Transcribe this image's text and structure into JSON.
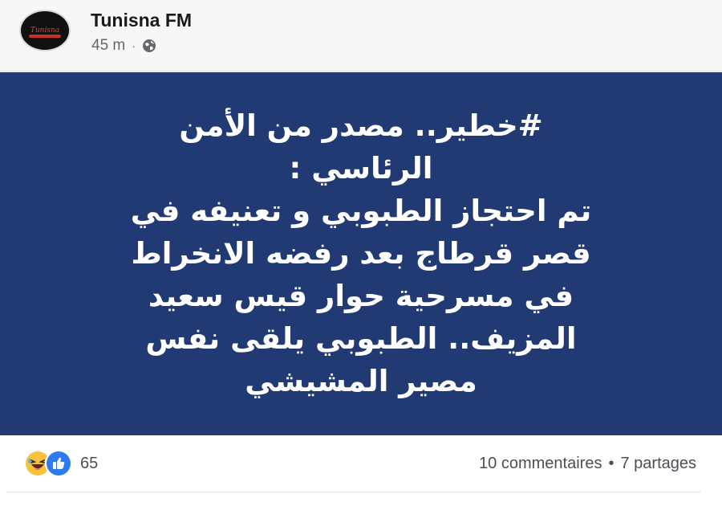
{
  "post": {
    "page_name": "Tunisna FM",
    "time_ago": "45 m",
    "separator": "·",
    "privacy_icon": "globe-icon",
    "avatar_logo_text": "Tunisna"
  },
  "image_text": {
    "lines": [
      "#خطير.. مصدر من الأمن",
      "الرئاسي :",
      "تم احتجاز الطبوبي و تعنيفه في",
      "قصر قرطاج بعد رفضه الانخراط",
      "في مسرحية حوار قيس سعيد",
      "المزيف.. الطبوبي يلقى نفس",
      "مصير المشيشي"
    ],
    "background_color": "#223a73",
    "text_color": "#ffffff"
  },
  "footer": {
    "reaction_icons": [
      "laugh-react-icon",
      "like-react-icon"
    ],
    "reaction_count": "65",
    "comments": "10 commentaires",
    "separator": "•",
    "shares": "7 partages"
  }
}
